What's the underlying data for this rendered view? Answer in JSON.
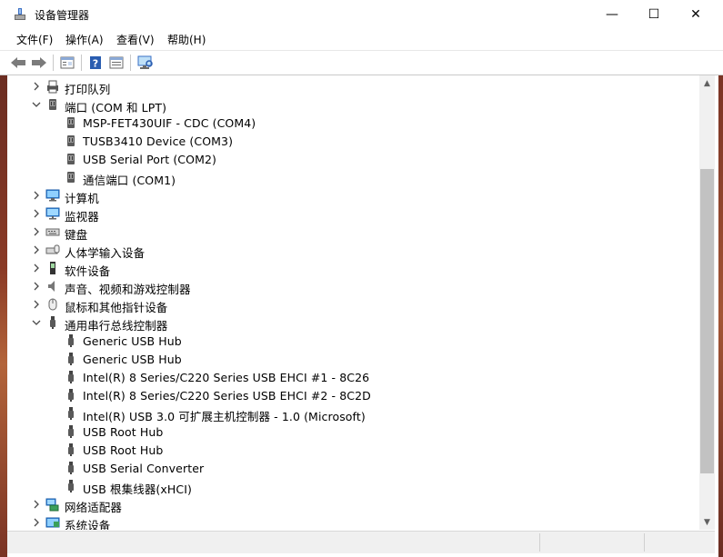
{
  "window": {
    "title": "设备管理器",
    "minimize_glyph": "—",
    "maximize_glyph": "☐",
    "close_glyph": "✕"
  },
  "menu": [
    "文件(F)",
    "操作(A)",
    "查看(V)",
    "帮助(H)"
  ],
  "toolbar_icons": [
    "back-icon",
    "forward-icon",
    "properties-icon",
    "help-icon",
    "update-driver-icon",
    "scan-hardware-icon"
  ],
  "tree": {
    "rows": [
      {
        "label": "打印队列",
        "level": 0,
        "expander": "collapsed",
        "icon": "printer-icon"
      },
      {
        "label": "端口 (COM 和 LPT)",
        "level": 0,
        "expander": "expanded",
        "icon": "port-icon"
      },
      {
        "label": "MSP-FET430UIF - CDC (COM4)",
        "level": 1,
        "expander": "none",
        "icon": "port-icon"
      },
      {
        "label": "TUSB3410 Device (COM3)",
        "level": 1,
        "expander": "none",
        "icon": "port-icon"
      },
      {
        "label": "USB Serial Port (COM2)",
        "level": 1,
        "expander": "none",
        "icon": "port-icon"
      },
      {
        "label": "通信端口 (COM1)",
        "level": 1,
        "expander": "none",
        "icon": "port-icon"
      },
      {
        "label": "计算机",
        "level": 0,
        "expander": "collapsed",
        "icon": "computer-icon"
      },
      {
        "label": "监视器",
        "level": 0,
        "expander": "collapsed",
        "icon": "monitor-icon"
      },
      {
        "label": "键盘",
        "level": 0,
        "expander": "collapsed",
        "icon": "keyboard-icon"
      },
      {
        "label": "人体学输入设备",
        "level": 0,
        "expander": "collapsed",
        "icon": "hid-icon"
      },
      {
        "label": "软件设备",
        "level": 0,
        "expander": "collapsed",
        "icon": "software-device-icon"
      },
      {
        "label": "声音、视频和游戏控制器",
        "level": 0,
        "expander": "collapsed",
        "icon": "speaker-icon"
      },
      {
        "label": "鼠标和其他指针设备",
        "level": 0,
        "expander": "collapsed",
        "icon": "mouse-icon"
      },
      {
        "label": "通用串行总线控制器",
        "level": 0,
        "expander": "expanded",
        "icon": "usb-icon"
      },
      {
        "label": "Generic USB Hub",
        "level": 1,
        "expander": "none",
        "icon": "usb-icon"
      },
      {
        "label": "Generic USB Hub",
        "level": 1,
        "expander": "none",
        "icon": "usb-icon"
      },
      {
        "label": "Intel(R) 8 Series/C220 Series USB EHCI #1 - 8C26",
        "level": 1,
        "expander": "none",
        "icon": "usb-icon"
      },
      {
        "label": "Intel(R) 8 Series/C220 Series USB EHCI #2 - 8C2D",
        "level": 1,
        "expander": "none",
        "icon": "usb-icon"
      },
      {
        "label": "Intel(R) USB 3.0 可扩展主机控制器 - 1.0 (Microsoft)",
        "level": 1,
        "expander": "none",
        "icon": "usb-icon"
      },
      {
        "label": "USB Root Hub",
        "level": 1,
        "expander": "none",
        "icon": "usb-icon"
      },
      {
        "label": "USB Root Hub",
        "level": 1,
        "expander": "none",
        "icon": "usb-icon"
      },
      {
        "label": "USB Serial Converter",
        "level": 1,
        "expander": "none",
        "icon": "usb-icon"
      },
      {
        "label": "USB 根集线器(xHCI)",
        "level": 1,
        "expander": "none",
        "icon": "usb-icon"
      },
      {
        "label": "网络适配器",
        "level": 0,
        "expander": "collapsed",
        "icon": "network-adapter-icon"
      },
      {
        "label": "系统设备",
        "level": 0,
        "expander": "collapsed",
        "icon": "system-device-icon"
      }
    ]
  },
  "colors": {
    "accent": "#1e73d8",
    "scrollbar_thumb": "#c2c2c2",
    "status_bg": "#f0f0f0"
  }
}
